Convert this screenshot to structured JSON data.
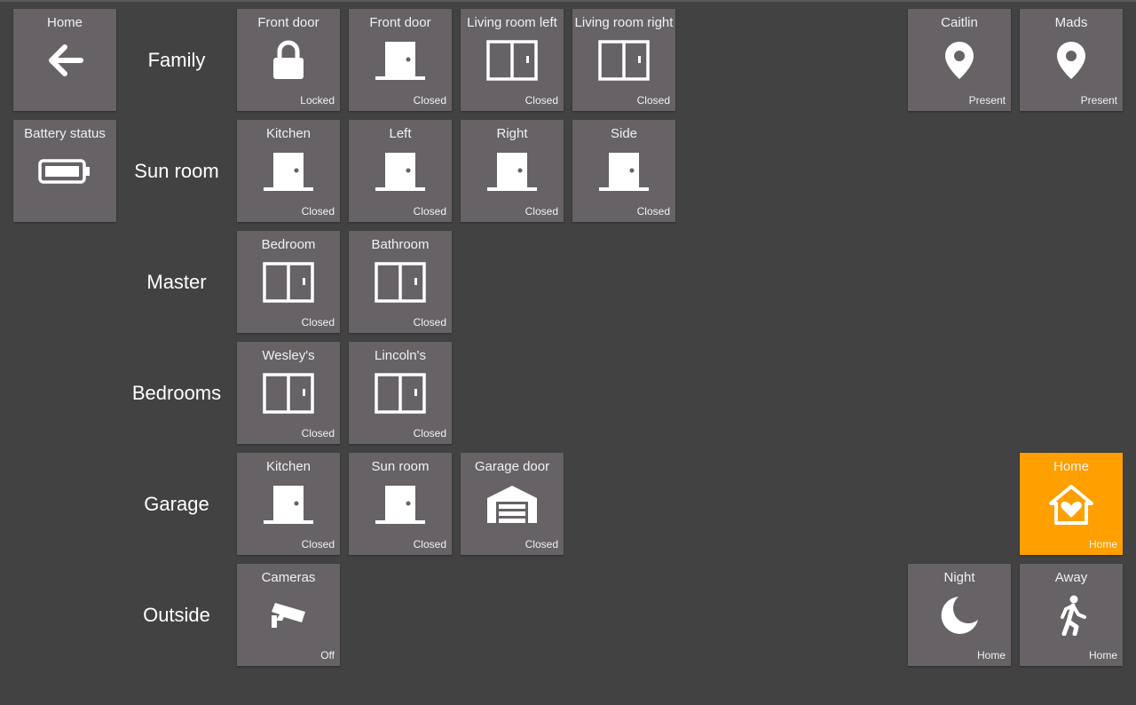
{
  "left": {
    "home": {
      "title": "Home",
      "icon": "arrow-left-icon"
    },
    "battery": {
      "title": "Battery status",
      "icon": "battery-icon"
    }
  },
  "rows": [
    {
      "label": "Family",
      "tiles": [
        {
          "title": "Front door",
          "status": "Locked",
          "icon": "lock-icon"
        },
        {
          "title": "Front door",
          "status": "Closed",
          "icon": "door-icon"
        },
        {
          "title": "Living room left",
          "status": "Closed",
          "icon": "sliding-door-icon"
        },
        {
          "title": "Living room right",
          "status": "Closed",
          "icon": "sliding-door-icon"
        }
      ]
    },
    {
      "label": "Sun room",
      "tiles": [
        {
          "title": "Kitchen",
          "status": "Closed",
          "icon": "door-icon"
        },
        {
          "title": "Left",
          "status": "Closed",
          "icon": "door-icon"
        },
        {
          "title": "Right",
          "status": "Closed",
          "icon": "door-icon"
        },
        {
          "title": "Side",
          "status": "Closed",
          "icon": "door-icon"
        }
      ]
    },
    {
      "label": "Master",
      "tiles": [
        {
          "title": "Bedroom",
          "status": "Closed",
          "icon": "sliding-door-icon"
        },
        {
          "title": "Bathroom",
          "status": "Closed",
          "icon": "sliding-door-icon"
        }
      ]
    },
    {
      "label": "Bedrooms",
      "tiles": [
        {
          "title": "Wesley's",
          "status": "Closed",
          "icon": "sliding-door-icon"
        },
        {
          "title": "Lincoln's",
          "status": "Closed",
          "icon": "sliding-door-icon"
        }
      ]
    },
    {
      "label": "Garage",
      "tiles": [
        {
          "title": "Kitchen",
          "status": "Closed",
          "icon": "door-icon"
        },
        {
          "title": "Sun room",
          "status": "Closed",
          "icon": "door-icon"
        },
        {
          "title": "Garage door",
          "status": "Closed",
          "icon": "garage-icon"
        }
      ]
    },
    {
      "label": "Outside",
      "tiles": [
        {
          "title": "Cameras",
          "status": "Off",
          "icon": "cctv-icon"
        }
      ]
    }
  ],
  "people": [
    {
      "title": "Caitlin",
      "status": "Present",
      "icon": "map-marker-icon"
    },
    {
      "title": "Mads",
      "status": "Present",
      "icon": "map-marker-icon"
    }
  ],
  "modes": {
    "home": {
      "title": "Home",
      "status": "Home",
      "icon": "home-heart-icon"
    },
    "night": {
      "title": "Night",
      "status": "Home",
      "icon": "moon-icon"
    },
    "away": {
      "title": "Away",
      "status": "Home",
      "icon": "walk-icon"
    }
  },
  "colors": {
    "background": "#424242",
    "tile": "#666266",
    "active": "#ffa000"
  }
}
